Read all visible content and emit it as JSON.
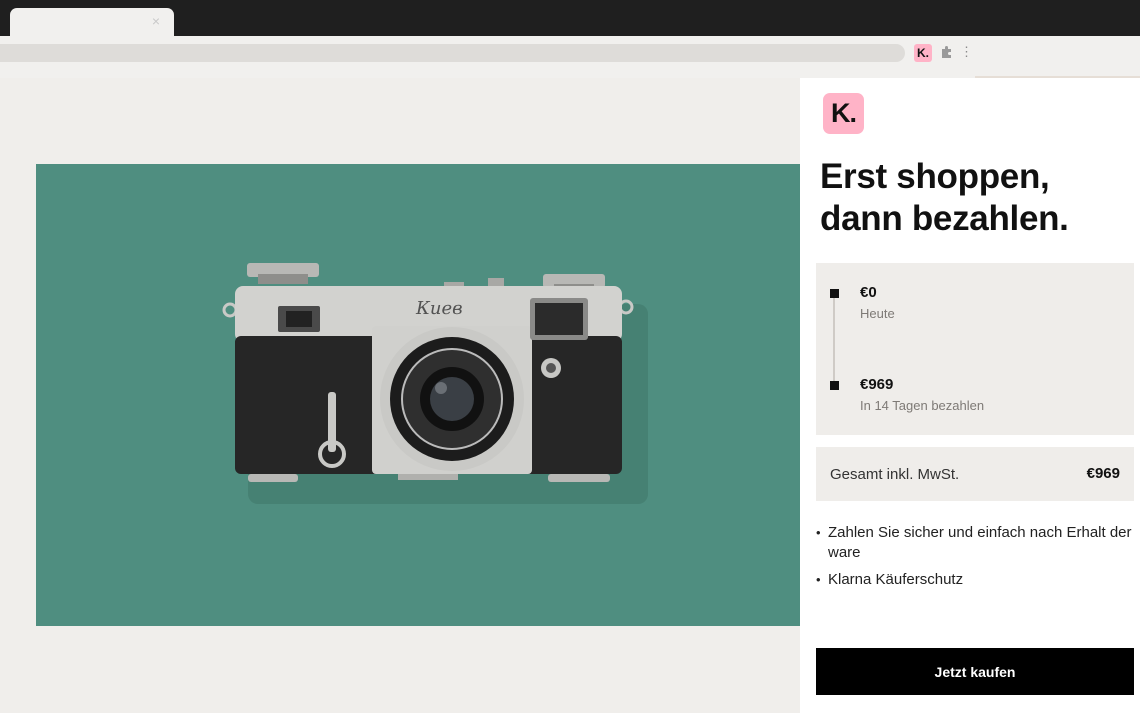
{
  "browser": {
    "tab_close_glyph": "×",
    "extension_logo_letter": "K.",
    "menu_glyph": "⋮",
    "icons": [
      "close-icon",
      "klarna-extension-icon",
      "puzzle-icon",
      "more-vertical-icon"
    ]
  },
  "colors": {
    "klarna_pink": "#ffb3c7",
    "image_background": "#4f8e80",
    "panel_background": "#ffffff",
    "box_background": "#efedea",
    "button_background": "#000000"
  },
  "klarna": {
    "logo_text": "K.",
    "headline_line1": "Erst shoppen,",
    "headline_line2": "dann bezahlen.",
    "schedule": [
      {
        "amount": "€0",
        "label": "Heute"
      },
      {
        "amount": "€969",
        "label": "In 14 Tagen bezahlen"
      }
    ],
    "total_label": "Gesamt inkl. MwSt.",
    "total_value": "€969",
    "benefits": [
      "Zahlen Sie sicher und einfach nach Erhalt der ware",
      "Klarna Käuferschutz"
    ],
    "button_label": "Jetzt kaufen"
  }
}
